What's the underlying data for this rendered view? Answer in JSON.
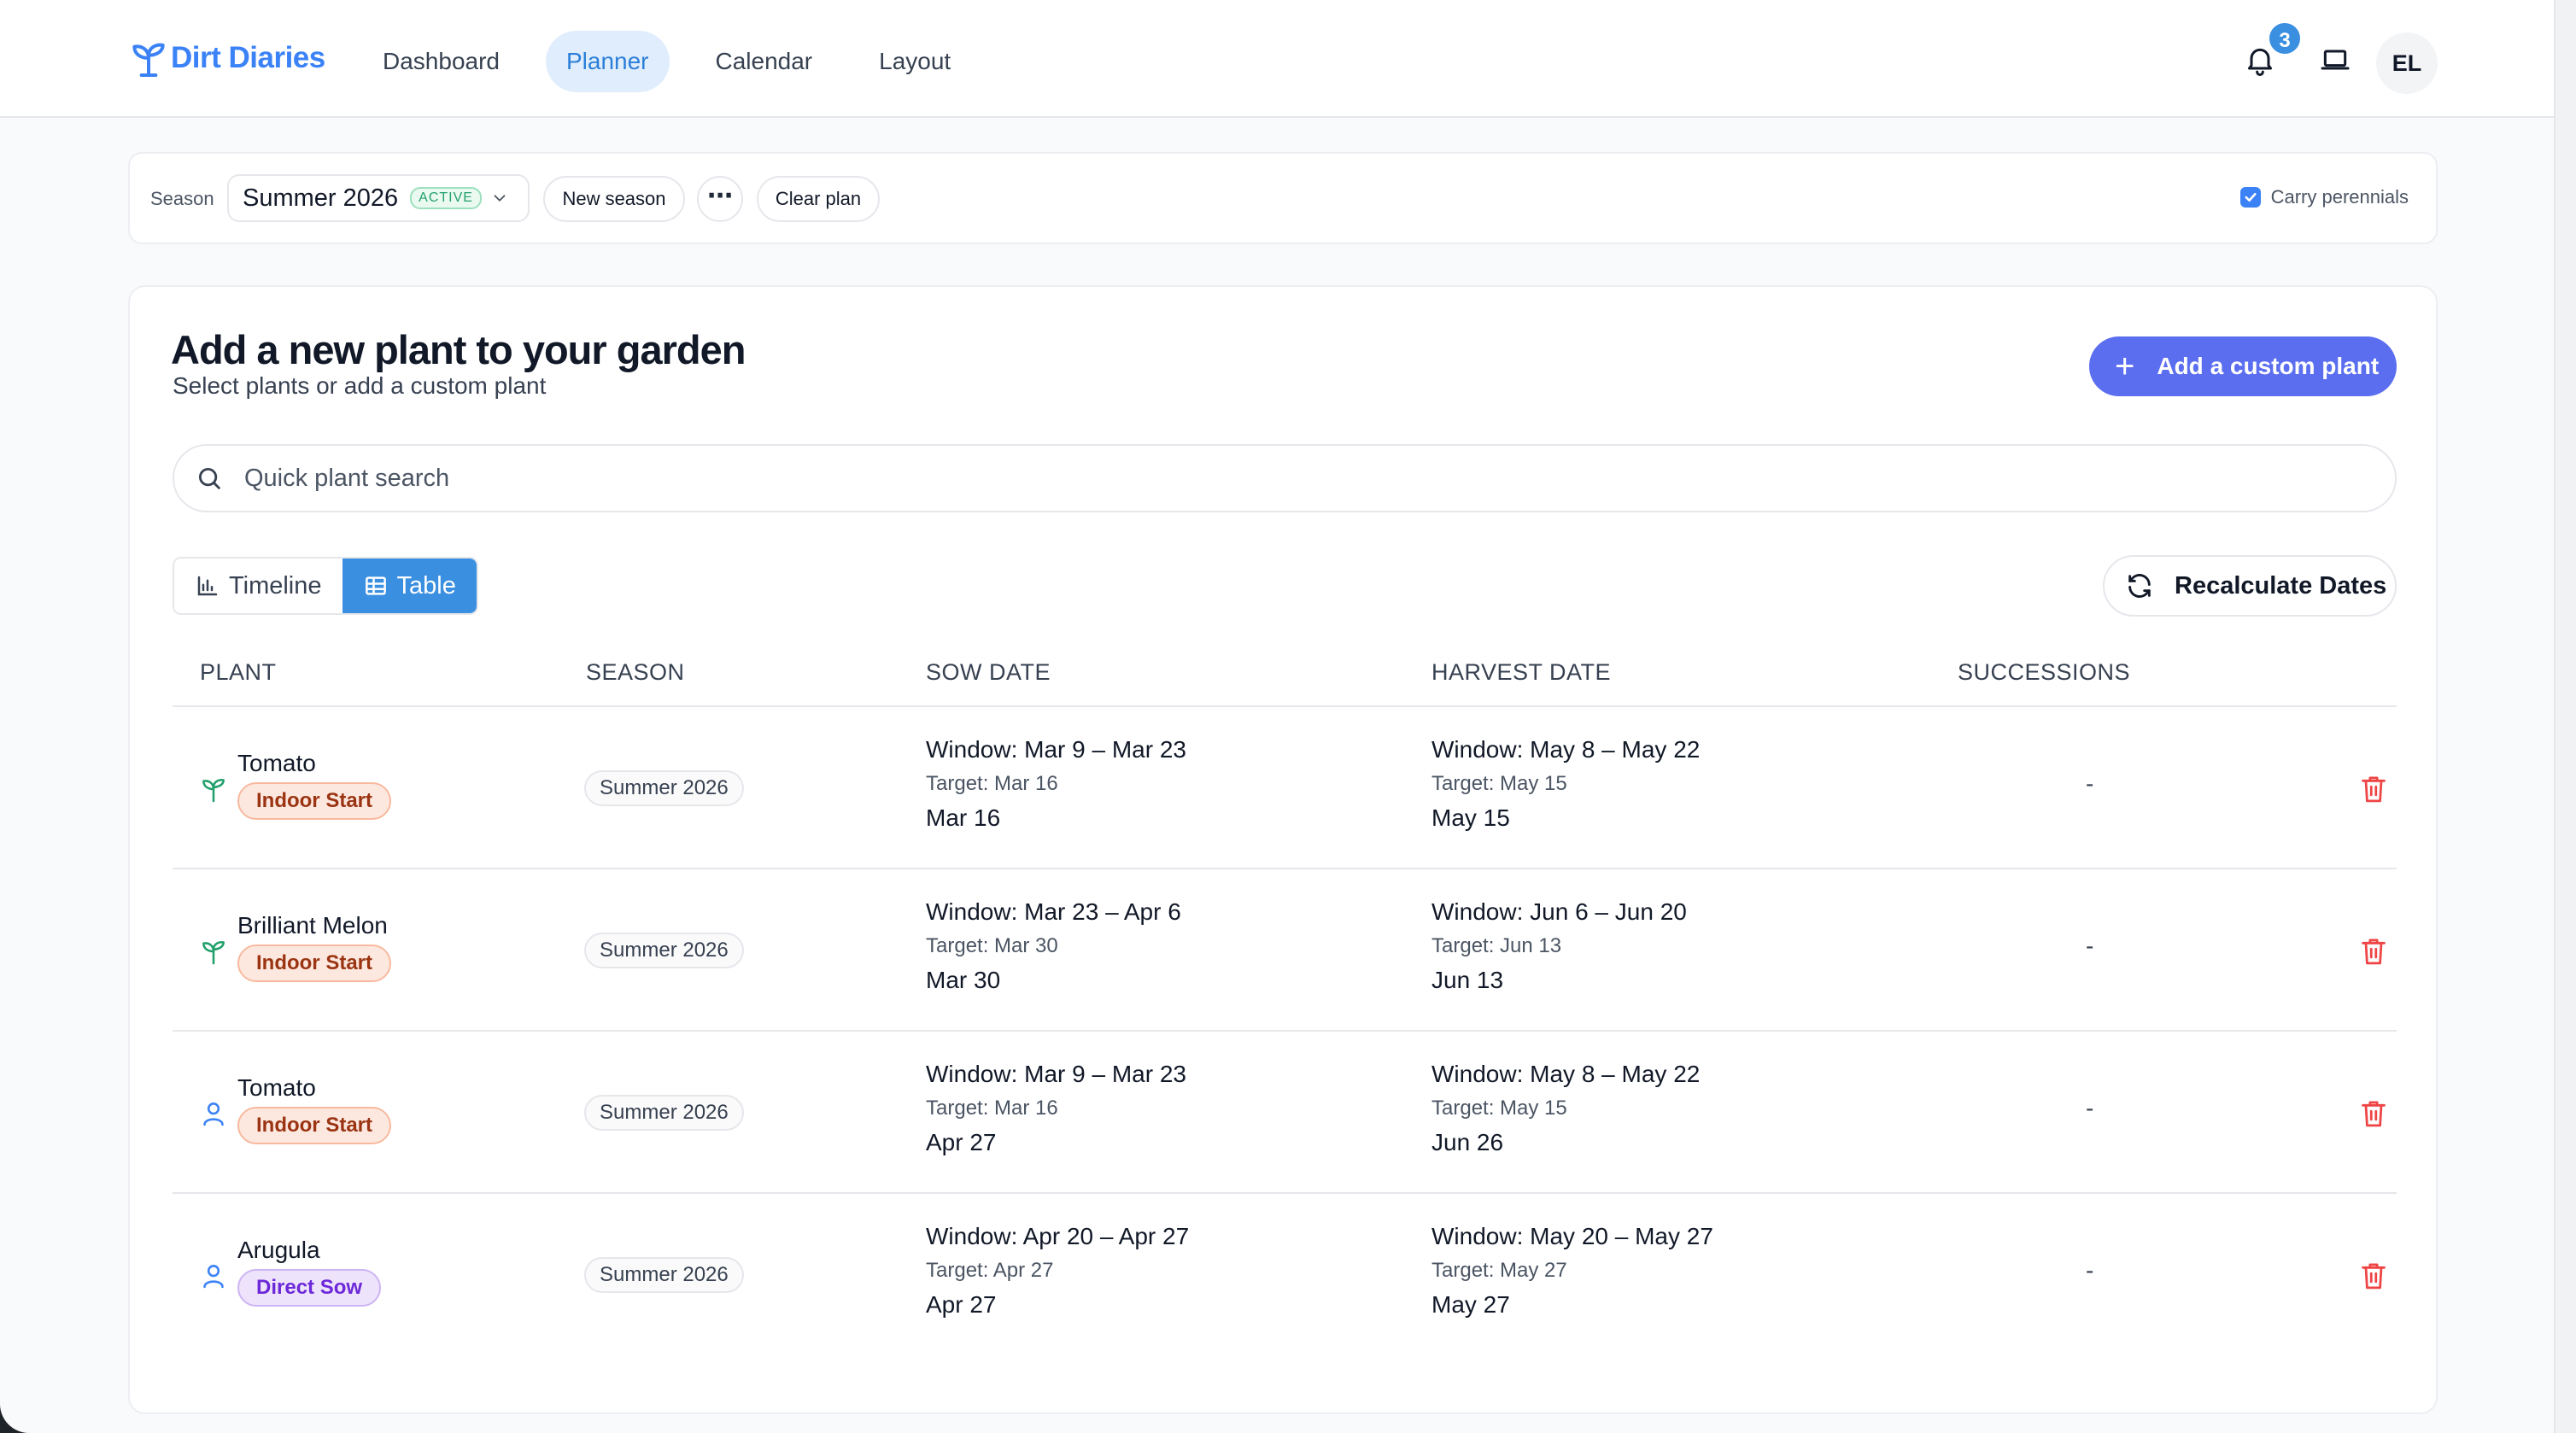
{
  "app": {
    "brand": "Dirt Diaries",
    "nav": [
      {
        "label": "Dashboard",
        "active": false
      },
      {
        "label": "Planner",
        "active": true
      },
      {
        "label": "Calendar",
        "active": false
      },
      {
        "label": "Layout",
        "active": false
      }
    ],
    "notifications_count": "3",
    "avatar_initials": "EL"
  },
  "season_bar": {
    "label": "Season",
    "selected_season": "Summer 2026",
    "active_badge": "ACTIVE",
    "new_season": "New season",
    "more": "⋯",
    "clear_plan": "Clear plan",
    "carry_perennials": "Carry perennials",
    "carry_perennials_checked": true
  },
  "card": {
    "title": "Add a new plant to your garden",
    "subtitle": "Select plants or add a custom plant",
    "add_custom": "Add a custom plant",
    "search_placeholder": "Quick plant search",
    "view_toggle": {
      "timeline": "Timeline",
      "table": "Table",
      "active": "table"
    },
    "recalculate": "Recalculate Dates"
  },
  "table": {
    "headers": {
      "plant": "PLANT",
      "season": "SEASON",
      "sow": "SOW DATE",
      "harvest": "HARVEST DATE",
      "successions": "SUCCESSIONS"
    },
    "rows": [
      {
        "icon": "sprout-icon",
        "plant": "Tomato",
        "tag": "Indoor Start",
        "tag_type": "indoor",
        "season": "Summer 2026",
        "sow_window": "Window: Mar 9 – Mar 23",
        "sow_target": "Target: Mar 16",
        "sow_date": "Mar 16",
        "harvest_window": "Window: May 8 – May 22",
        "harvest_target": "Target: May 15",
        "harvest_date": "May 15",
        "successions": "-"
      },
      {
        "icon": "sprout-icon",
        "plant": "Brilliant Melon",
        "tag": "Indoor Start",
        "tag_type": "indoor",
        "season": "Summer 2026",
        "sow_window": "Window: Mar 23 – Apr 6",
        "sow_target": "Target: Mar 30",
        "sow_date": "Mar 30",
        "harvest_window": "Window: Jun 6 – Jun 20",
        "harvest_target": "Target: Jun 13",
        "harvest_date": "Jun 13",
        "successions": "-"
      },
      {
        "icon": "user-icon",
        "plant": "Tomato",
        "tag": "Indoor Start",
        "tag_type": "indoor",
        "season": "Summer 2026",
        "sow_window": "Window: Mar 9 – Mar 23",
        "sow_target": "Target: Mar 16",
        "sow_date": "Apr 27",
        "harvest_window": "Window: May 8 – May 22",
        "harvest_target": "Target: May 15",
        "harvest_date": "Jun 26",
        "successions": "-"
      },
      {
        "icon": "user-icon",
        "plant": "Arugula",
        "tag": "Direct Sow",
        "tag_type": "direct",
        "season": "Summer 2026",
        "sow_window": "Window: Apr 20 – Apr 27",
        "sow_target": "Target: Apr 27",
        "sow_date": "Apr 27",
        "harvest_window": "Window: May 20 – May 27",
        "harvest_target": "Target: May 27",
        "harvest_date": "May 27",
        "successions": "-"
      }
    ]
  },
  "colors": {
    "accent": "#3b8fe0",
    "primary_button": "#5b6ef0",
    "sprout_icon": "#22a06b",
    "user_icon": "#3b82f6",
    "delete": "#ef4444"
  }
}
